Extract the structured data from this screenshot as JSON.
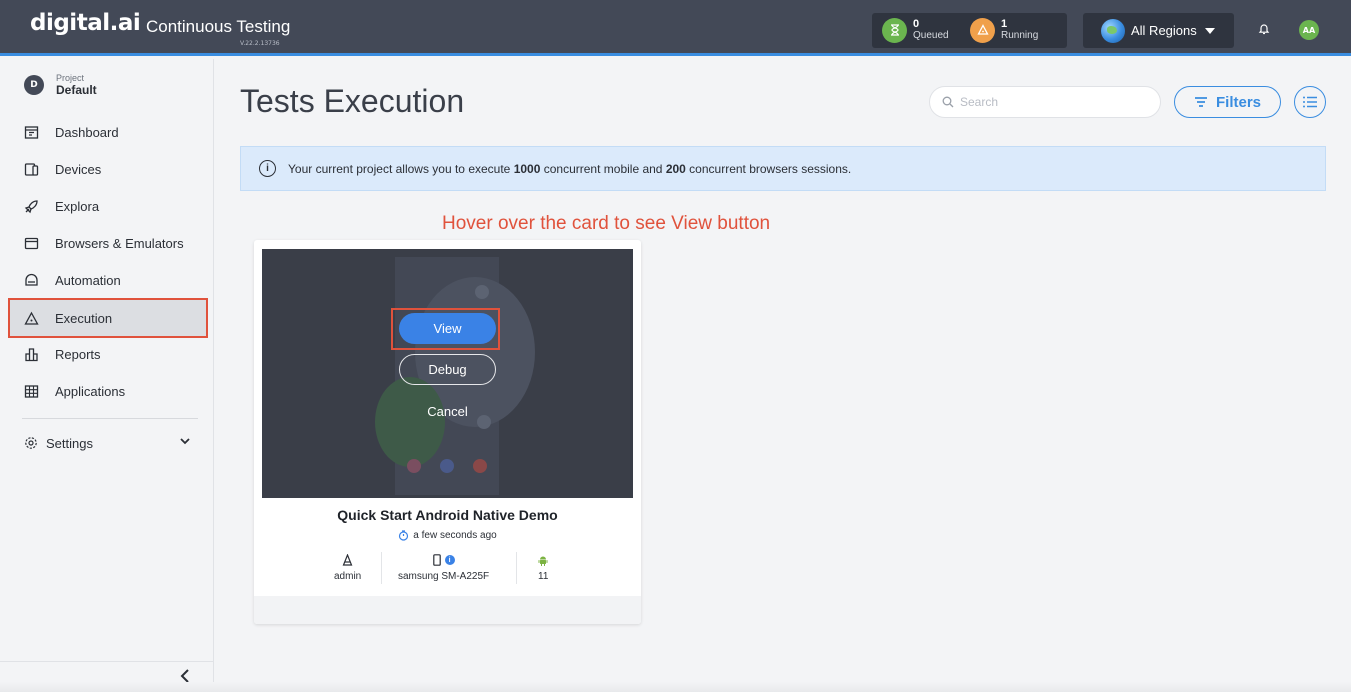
{
  "header": {
    "logo": "digital.ai",
    "product": "Continuous Testing",
    "version": "V.22.2.13736",
    "queued_count": "0",
    "queued_label": "Queued",
    "running_count": "1",
    "running_label": "Running",
    "region": "All Regions",
    "user_initials": "AA"
  },
  "sidebar": {
    "project_badge": "D",
    "project_caption": "Project",
    "project_name": "Default",
    "items": [
      {
        "label": "Dashboard",
        "icon": "dashboard-icon"
      },
      {
        "label": "Devices",
        "icon": "devices-icon"
      },
      {
        "label": "Explora",
        "icon": "rocket-icon"
      },
      {
        "label": "Browsers & Emulators",
        "icon": "browser-icon"
      },
      {
        "label": "Automation",
        "icon": "automation-icon"
      },
      {
        "label": "Execution",
        "icon": "execution-icon",
        "active": true
      },
      {
        "label": "Reports",
        "icon": "reports-icon"
      },
      {
        "label": "Applications",
        "icon": "applications-icon"
      }
    ],
    "settings_label": "Settings"
  },
  "main": {
    "title": "Tests Execution",
    "search_placeholder": "Search",
    "filters_label": "Filters",
    "banner": {
      "prefix": "Your current project allows you to execute ",
      "mobile_count": "1000",
      "middle": " concurrent mobile and ",
      "browser_count": "200",
      "suffix": " concurrent browsers sessions."
    },
    "annotation": "Hover over the card to see View button",
    "card": {
      "view_label": "View",
      "debug_label": "Debug",
      "cancel_label": "Cancel",
      "title": "Quick Start Android Native Demo",
      "time": "a few seconds ago",
      "user": "admin",
      "device": "samsung SM-A225F",
      "os_version": "11"
    }
  },
  "colors": {
    "topbar": "#434957",
    "accent": "#3a8de0",
    "highlight": "#e0523c",
    "queued": "#6bb54f",
    "running": "#f0a04b"
  }
}
